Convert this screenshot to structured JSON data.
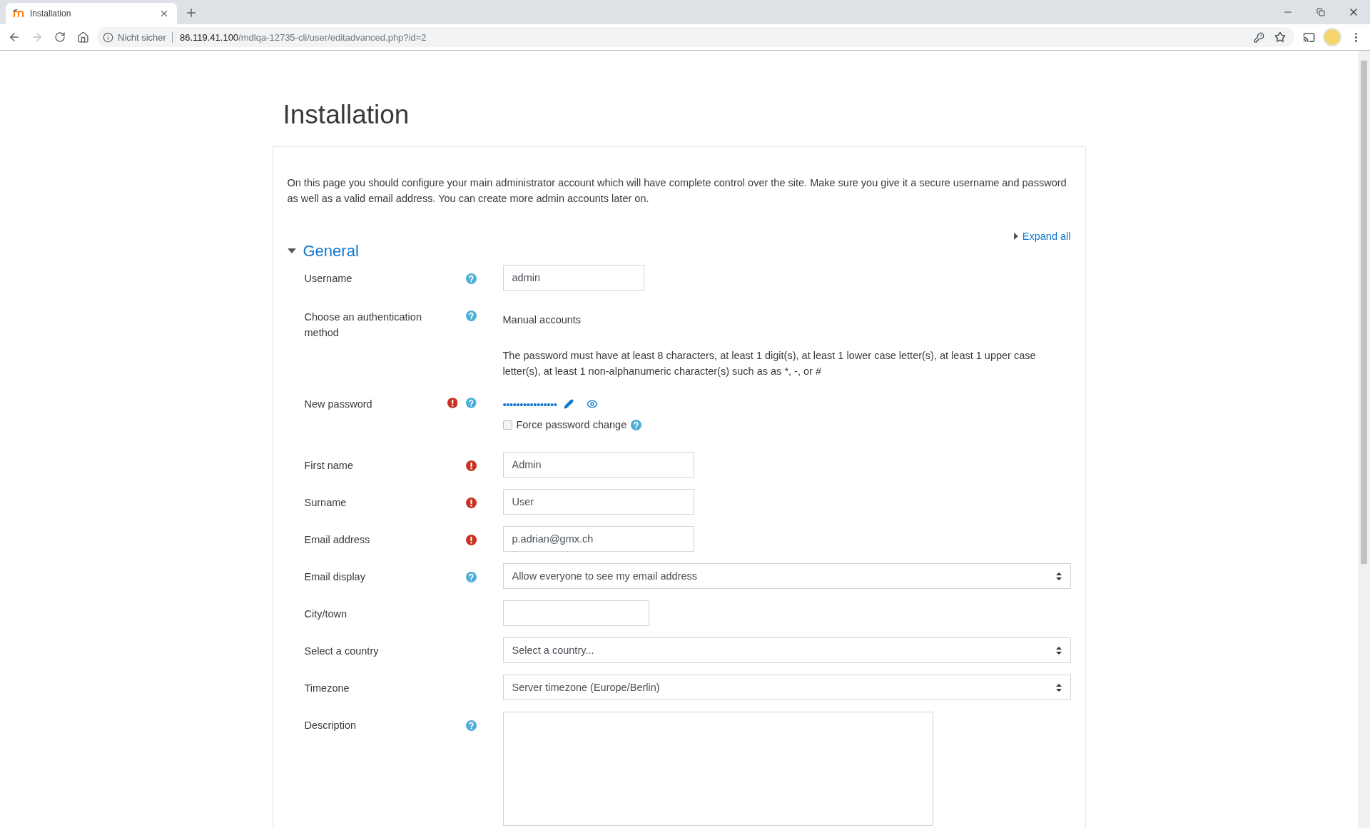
{
  "browser": {
    "tab_title": "Installation",
    "security_label": "Nicht sicher",
    "url_host": "86.119.41.100",
    "url_path": "/mdlqa-12735-cli/user/editadvanced.php?id=2"
  },
  "page": {
    "title": "Installation",
    "intro": "On this page you should configure your main administrator account which will have complete control over the site. Make sure you give it a secure username and password as well as a valid email address. You can create more admin accounts later on.",
    "expand_all": "Expand all"
  },
  "section": {
    "title": "General",
    "expanded": true
  },
  "fields": [
    {
      "kind": "text",
      "label": "Username",
      "required": false,
      "help": true,
      "value": "admin"
    },
    {
      "kind": "static",
      "label": "Choose an authentication method",
      "required": false,
      "help": true,
      "value": "Manual accounts"
    },
    {
      "kind": "note",
      "text": "The password must have at least 8 characters, at least 1 digit(s), at least 1 lower case letter(s), at least 1 upper case letter(s), at least 1 non-alphanumeric character(s) such as as *, -, or #"
    },
    {
      "kind": "password",
      "label": "New password",
      "required": true,
      "help": true,
      "value": "••••••••••••••••",
      "option": {
        "label": "Force password change",
        "checked": false,
        "help": true
      }
    },
    {
      "kind": "text",
      "label": "First name",
      "required": true,
      "help": false,
      "value": "Admin"
    },
    {
      "kind": "text",
      "label": "Surname",
      "required": true,
      "help": false,
      "value": "User"
    },
    {
      "kind": "text",
      "label": "Email address",
      "required": true,
      "help": false,
      "value": "p.adrian@gmx.ch"
    },
    {
      "kind": "select",
      "label": "Email display",
      "required": false,
      "help": true,
      "value": "Allow everyone to see my email address"
    },
    {
      "kind": "text",
      "label": "City/town",
      "required": false,
      "help": false
    },
    {
      "kind": "select",
      "label": "Select a country",
      "required": false,
      "help": false,
      "value": "Select a country..."
    },
    {
      "kind": "select",
      "label": "Timezone",
      "required": false,
      "help": false,
      "value": "Server timezone (Europe/Berlin)"
    },
    {
      "kind": "textarea",
      "label": "Description",
      "required": false,
      "help": true
    }
  ]
}
